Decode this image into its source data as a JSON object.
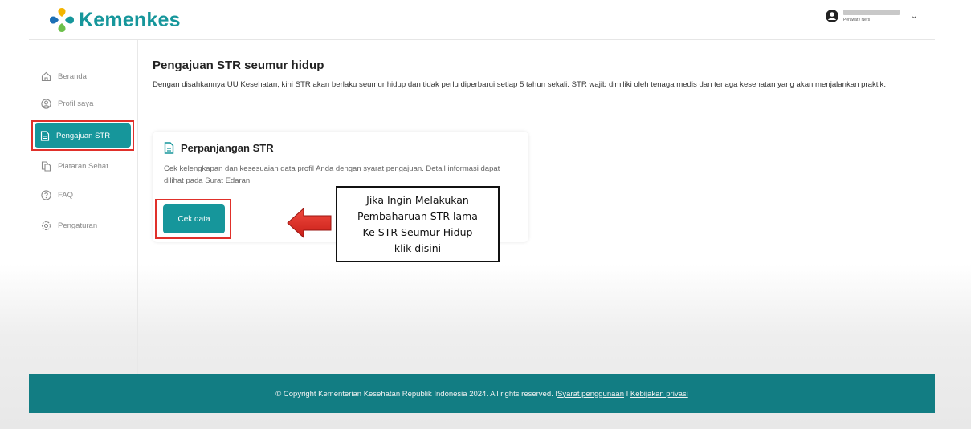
{
  "header": {
    "logo_text": "Kemenkes",
    "user_role": "Perawat / Ners"
  },
  "sidebar": {
    "items": [
      {
        "label": "Beranda",
        "icon": "home-icon"
      },
      {
        "label": "Profil saya",
        "icon": "user-circle-icon"
      },
      {
        "label": "Pengajuan STR",
        "icon": "document-icon",
        "active": true
      },
      {
        "label": "Plataran Sehat",
        "icon": "documents-icon"
      },
      {
        "label": "FAQ",
        "icon": "question-circle-icon"
      },
      {
        "label": "Pengaturan",
        "icon": "gear-icon"
      }
    ]
  },
  "main": {
    "title": "Pengajuan STR seumur hidup",
    "description": "Dengan disahkannya UU Kesehatan, kini STR akan berlaku seumur hidup dan tidak perlu diperbarui setiap 5 tahun sekali. STR wajib dimiliki oleh tenaga medis dan tenaga kesehatan yang akan menjalankan praktik.",
    "card": {
      "title": "Perpanjangan STR",
      "description": "Cek kelengkapan dan kesesuaian data profil Anda dengan syarat pengajuan. Detail informasi dapat dilihat pada Surat Edaran",
      "button_label": "Cek data"
    }
  },
  "annotation": {
    "lines": [
      "Jika Ingin Melakukan",
      "Pembaharuan STR lama",
      "Ke STR Seumur Hidup",
      "klik disini"
    ]
  },
  "footer": {
    "copyright": "© Copyright Kementerian Kesehatan Republik Indonesia 2024. All rights reserved. I ",
    "terms_link": "Syarat penggunaan",
    "separator": " I ",
    "privacy_link": "Kebijakan privasi"
  },
  "colors": {
    "brand": "#16969b",
    "footer": "#127d83",
    "highlight": "#e0302a"
  }
}
